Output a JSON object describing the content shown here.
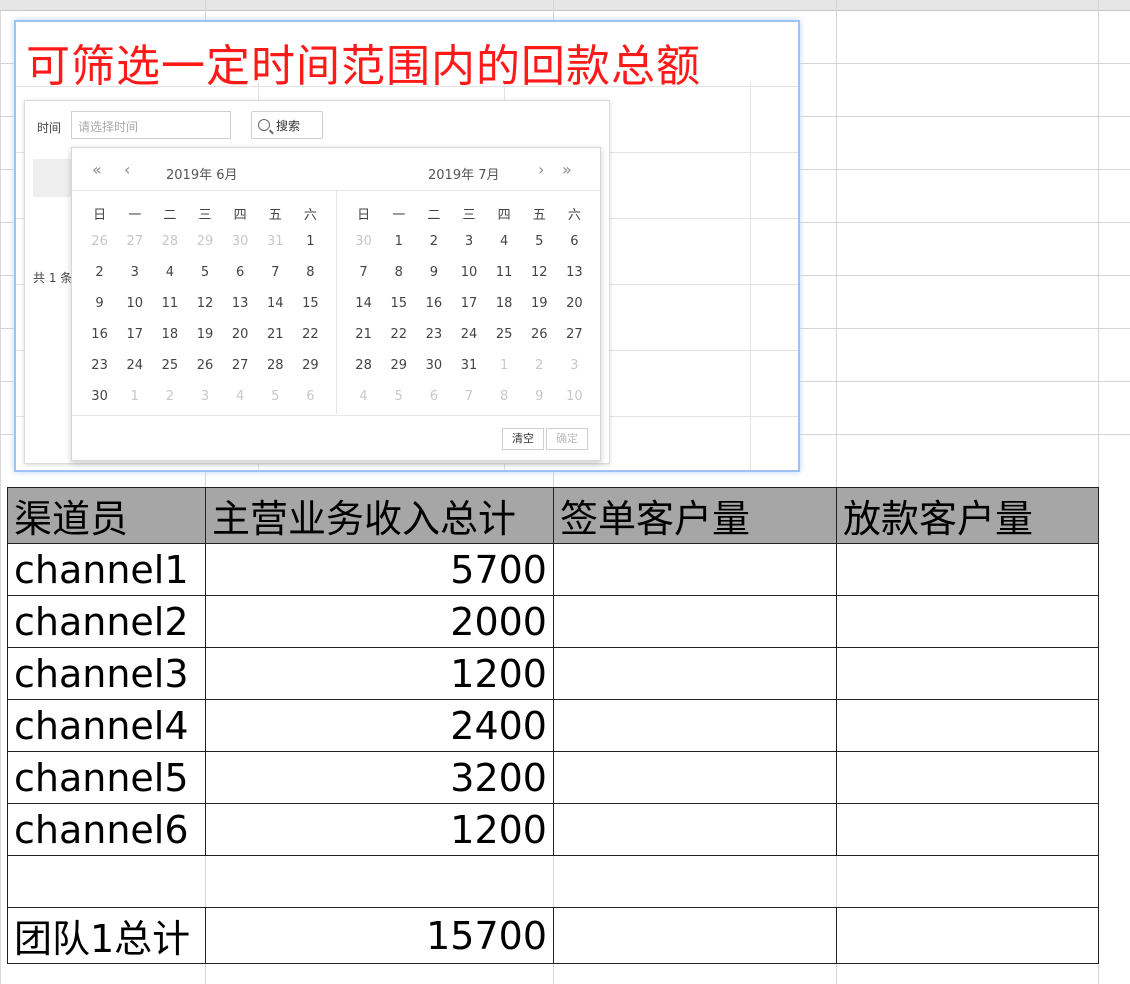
{
  "embedded_image": {
    "title": "可筛选一定时间范围内的回款总额",
    "time_label": "时间",
    "time_placeholder": "请选择时间",
    "search_label": "搜索",
    "total_prefix": "共 1 条",
    "calendar": {
      "left_header": "2019年  6月",
      "right_header": "2019年  7月",
      "weekdays": [
        "日",
        "一",
        "二",
        "三",
        "四",
        "五",
        "六"
      ],
      "left_days": [
        [
          "26",
          "27",
          "28",
          "29",
          "30",
          "31",
          "1"
        ],
        [
          "2",
          "3",
          "4",
          "5",
          "6",
          "7",
          "8"
        ],
        [
          "9",
          "10",
          "11",
          "12",
          "13",
          "14",
          "15"
        ],
        [
          "16",
          "17",
          "18",
          "19",
          "20",
          "21",
          "22"
        ],
        [
          "23",
          "24",
          "25",
          "26",
          "27",
          "28",
          "29"
        ],
        [
          "30",
          "1",
          "2",
          "3",
          "4",
          "5",
          "6"
        ]
      ],
      "right_days": [
        [
          "30",
          "1",
          "2",
          "3",
          "4",
          "5",
          "6"
        ],
        [
          "7",
          "8",
          "9",
          "10",
          "11",
          "12",
          "13"
        ],
        [
          "14",
          "15",
          "16",
          "17",
          "18",
          "19",
          "20"
        ],
        [
          "21",
          "22",
          "23",
          "24",
          "25",
          "26",
          "27"
        ],
        [
          "28",
          "29",
          "30",
          "31",
          "1",
          "2",
          "3"
        ],
        [
          "4",
          "5",
          "6",
          "7",
          "8",
          "9",
          "10"
        ]
      ],
      "clear_label": "清空",
      "confirm_label": "确定"
    }
  },
  "table": {
    "headers": [
      "渠道员",
      "主营业务收入总计",
      "签单客户量",
      "放款客户量"
    ],
    "rows": [
      {
        "name": "channel1",
        "revenue": "5700"
      },
      {
        "name": "channel2",
        "revenue": "2000"
      },
      {
        "name": "channel3",
        "revenue": "1200"
      },
      {
        "name": "channel4",
        "revenue": "2400"
      },
      {
        "name": "channel5",
        "revenue": "3200"
      },
      {
        "name": "channel6",
        "revenue": "1200"
      }
    ],
    "total_label": "团队1总计",
    "total_value": "15700"
  }
}
